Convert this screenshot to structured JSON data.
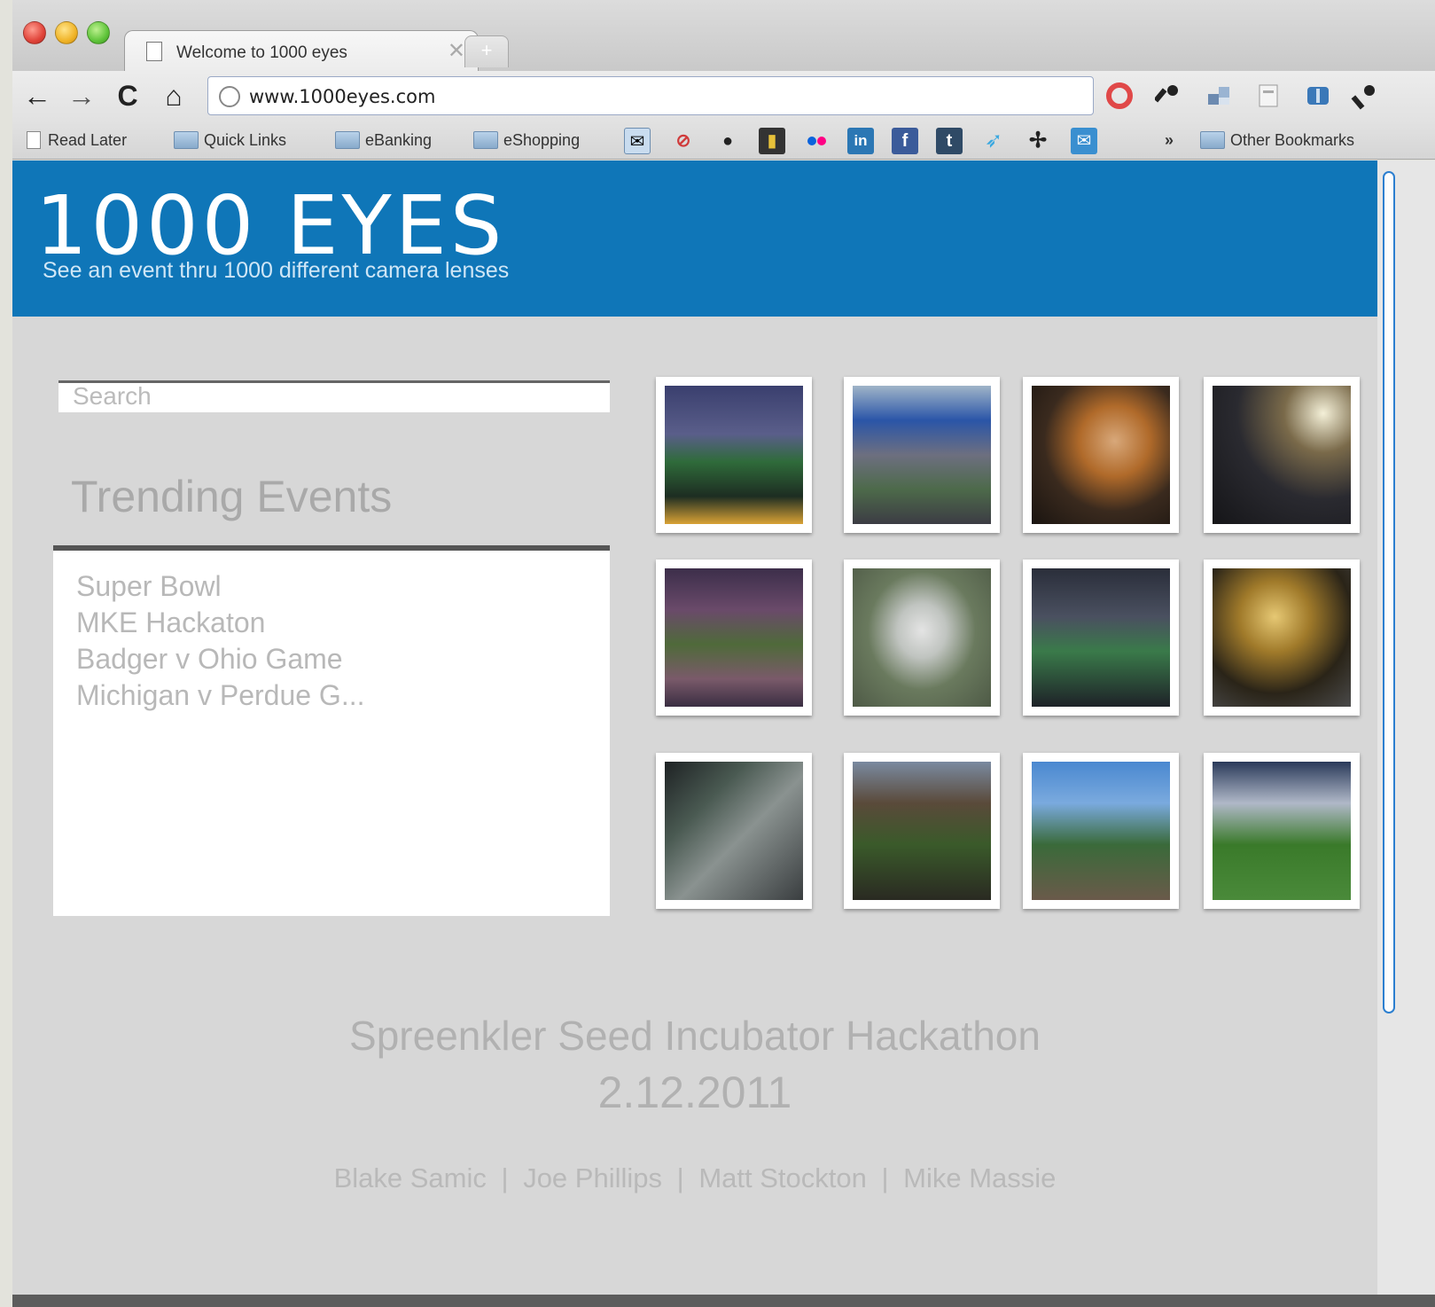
{
  "browser": {
    "tab_title": "Welcome to 1000 eyes",
    "tab_close": "✕",
    "new_tab": "+",
    "url": "www.1000eyes.com",
    "nav": {
      "back": "←",
      "forward": "→",
      "reload": "C",
      "home": "⌂"
    },
    "bookmarks": {
      "read_later": "Read Later",
      "quick_links": "Quick Links",
      "ebanking": "eBanking",
      "eshopping": "eShopping",
      "overflow": "»",
      "other": "Other Bookmarks"
    }
  },
  "header": {
    "logo": "1000 EYES",
    "tagline": "See an event thru 1000 different camera lenses"
  },
  "search": {
    "placeholder": "Search"
  },
  "trending": {
    "title": "Trending Events",
    "items": [
      "Super Bowl",
      "MKE Hackaton",
      "Badger v Ohio Game",
      "Michigan v Perdue G..."
    ]
  },
  "footer": {
    "title": "Spreenkler Seed Incubator Hackathon",
    "date": "2.12.2011",
    "credits": [
      "Blake Samic",
      "Joe Phillips",
      "Matt Stockton",
      "Mike Massie"
    ],
    "separator": "|"
  },
  "colors": {
    "header_blue": "#0f76b8",
    "page_bg": "#d7d7d7"
  }
}
